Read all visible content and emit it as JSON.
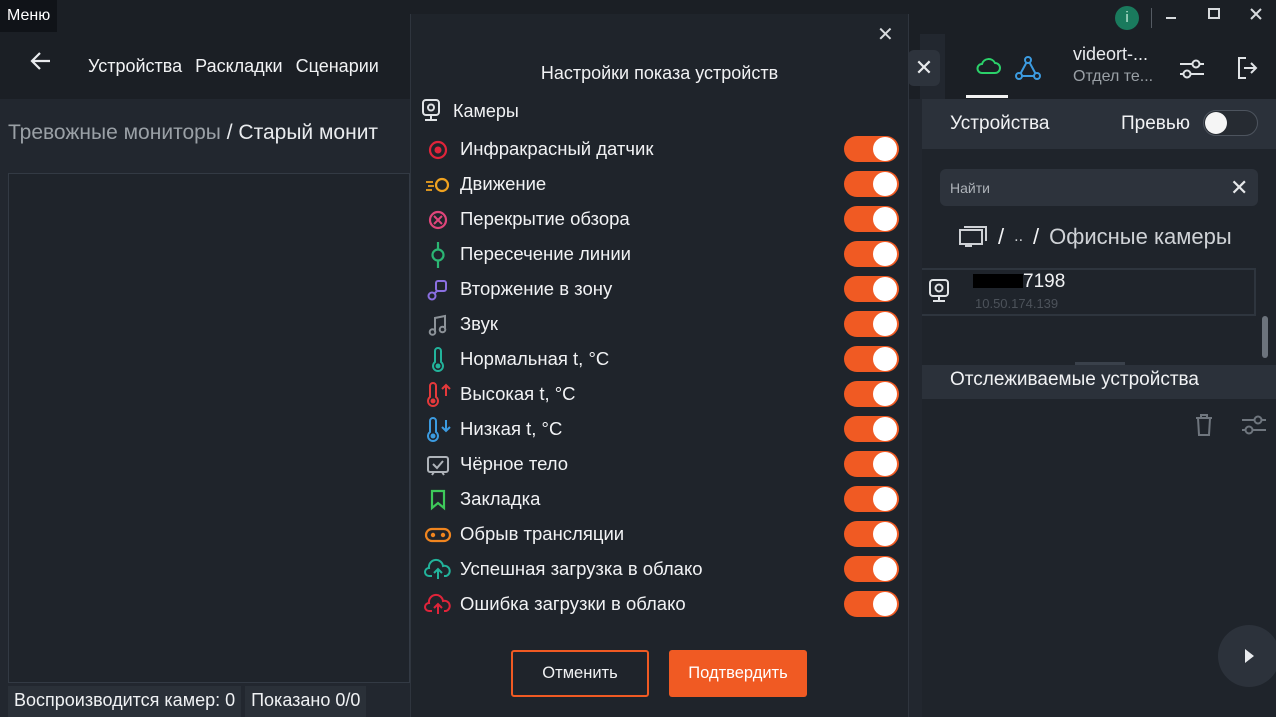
{
  "window": {
    "menu_label": "Меню",
    "info_label": "i"
  },
  "header": {
    "nav": [
      "Устройства",
      "Раскладки",
      "Сценарии"
    ]
  },
  "breadcrumb": {
    "parent": "Тревожные мониторы",
    "separator": " / ",
    "current": "Старый монит"
  },
  "status_bar": {
    "playing": "Воспроизводится камер: 0",
    "shown": "Показано 0/0"
  },
  "user": {
    "name": "videort-...",
    "department": "Отдел те..."
  },
  "right_panel": {
    "tab_title": "Устройства",
    "preview_label": "Превью",
    "preview_on": false,
    "search_placeholder": "Найти",
    "path_up": "..",
    "path_sep": "/",
    "folder": "Офисные камеры",
    "device_name_suffix": "7198",
    "device_ip": "10.50.174.139",
    "monitored_title": "Отслеживаемые устройства"
  },
  "modal": {
    "title": "Настройки показа устройств",
    "section": "Камеры",
    "options": [
      {
        "label": "Инфракрасный датчик",
        "icon": "infrared-icon",
        "color": "#e0243a",
        "on": true
      },
      {
        "label": "Движение",
        "icon": "motion-icon",
        "color": "#f0a21f",
        "on": true
      },
      {
        "label": "Перекрытие обзора",
        "icon": "view-blocked-icon",
        "color": "#e0457a",
        "on": true
      },
      {
        "label": "Пересечение линии",
        "icon": "line-crossing-icon",
        "color": "#2bb673",
        "on": true
      },
      {
        "label": "Вторжение в зону",
        "icon": "zone-intrusion-icon",
        "color": "#8a6fe0",
        "on": true
      },
      {
        "label": "Звук",
        "icon": "sound-icon",
        "color": "#8c9298",
        "on": true
      },
      {
        "label": "Нормальная t, °C",
        "icon": "temp-normal-icon",
        "color": "#22b39b",
        "on": true
      },
      {
        "label": "Высокая t, °C",
        "icon": "temp-high-icon",
        "color": "#e5393b",
        "on": true
      },
      {
        "label": "Низкая t, °C",
        "icon": "temp-low-icon",
        "color": "#3c9be0",
        "on": true
      },
      {
        "label": "Чёрное тело",
        "icon": "blackbody-icon",
        "color": "#aeb3b9",
        "on": true
      },
      {
        "label": "Закладка",
        "icon": "bookmark-icon",
        "color": "#3ec95a",
        "on": true
      },
      {
        "label": "Обрыв трансляции",
        "icon": "stream-break-icon",
        "color": "#f0851f",
        "on": true
      },
      {
        "label": "Успешная загрузка в облако",
        "icon": "cloud-upload-ok-icon",
        "color": "#22b39b",
        "on": true
      },
      {
        "label": "Ошибка загрузки в облако",
        "icon": "cloud-upload-error-icon",
        "color": "#e0243a",
        "on": true
      }
    ],
    "cancel_label": "Отменить",
    "confirm_label": "Подтвердить"
  }
}
